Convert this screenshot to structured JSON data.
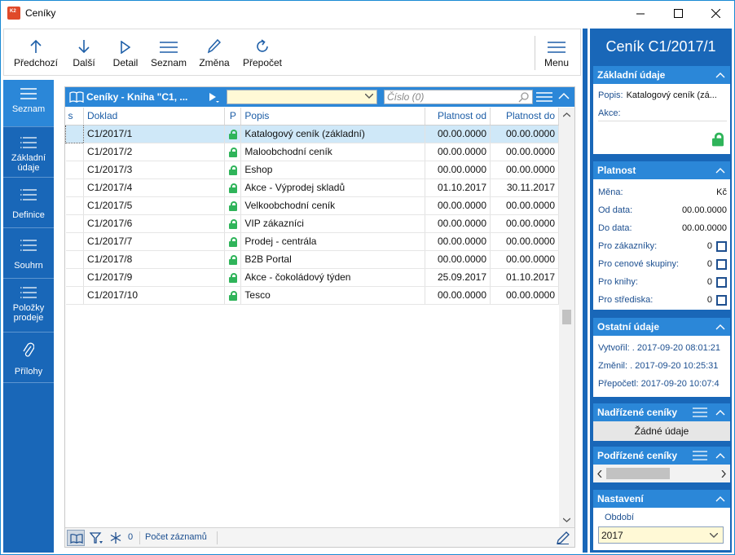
{
  "window": {
    "title": "Ceníky"
  },
  "toolbar": {
    "buttons": [
      {
        "label": "Předchozí",
        "icon": "arrow-up-icon"
      },
      {
        "label": "Další",
        "icon": "arrow-down-icon"
      },
      {
        "label": "Detail",
        "icon": "play-icon"
      },
      {
        "label": "Seznam",
        "icon": "list-icon"
      },
      {
        "label": "Změna",
        "icon": "pencil-icon"
      },
      {
        "label": "Přepočet",
        "icon": "refresh-icon"
      }
    ],
    "menu_label": "Menu"
  },
  "leftnav": {
    "items": [
      {
        "label": "Seznam",
        "active": true
      },
      {
        "label": "Základní údaje"
      },
      {
        "label": "Definice"
      },
      {
        "label": "Souhrn"
      },
      {
        "label": "Položky prodeje"
      },
      {
        "label": "Přílohy"
      }
    ]
  },
  "grid": {
    "title": "Ceníky - Kniha \"C1, ...",
    "filter_value": "",
    "number_placeholder": "Číslo (0)",
    "columns": [
      "s",
      "Doklad",
      "P",
      "Popis",
      "Platnost od",
      "Platnost do"
    ],
    "rows": [
      {
        "doklad": "C1/2017/1",
        "popis": "Katalogový ceník (základní)",
        "od": "00.00.0000",
        "do": "00.00.0000"
      },
      {
        "doklad": "C1/2017/2",
        "popis": "Maloobchodní ceník",
        "od": "00.00.0000",
        "do": "00.00.0000"
      },
      {
        "doklad": "C1/2017/3",
        "popis": "Eshop",
        "od": "00.00.0000",
        "do": "00.00.0000"
      },
      {
        "doklad": "C1/2017/4",
        "popis": "Akce - Výprodej skladů",
        "od": "01.10.2017",
        "do": "30.11.2017"
      },
      {
        "doklad": "C1/2017/5",
        "popis": "Velkoobchodní ceník",
        "od": "00.00.0000",
        "do": "00.00.0000"
      },
      {
        "doklad": "C1/2017/6",
        "popis": "VIP zákazníci",
        "od": "00.00.0000",
        "do": "00.00.0000"
      },
      {
        "doklad": "C1/2017/7",
        "popis": "Prodej - centrála",
        "od": "00.00.0000",
        "do": "00.00.0000"
      },
      {
        "doklad": "C1/2017/8",
        "popis": "B2B Portal",
        "od": "00.00.0000",
        "do": "00.00.0000"
      },
      {
        "doklad": "C1/2017/9",
        "popis": "Akce - čokoládový týden",
        "od": "25.09.2017",
        "do": "01.10.2017"
      },
      {
        "doklad": "C1/2017/10",
        "popis": "Tesco",
        "od": "00.00.0000",
        "do": "00.00.0000"
      }
    ],
    "footer": {
      "count": "0",
      "count_label": "Počet záznamů"
    }
  },
  "detail": {
    "title": "Ceník C1/2017/1",
    "zakladni": {
      "header": "Základní údaje",
      "popis_label": "Popis:",
      "popis_value": "Katalogový ceník (zá...",
      "akce_label": "Akce:"
    },
    "platnost": {
      "header": "Platnost",
      "mena_label": "Měna:",
      "mena_value": "Kč",
      "od_label": "Od data:",
      "od_value": "00.00.0000",
      "do_label": "Do data:",
      "do_value": "00.00.0000",
      "checks": [
        {
          "label": "Pro zákazníky:",
          "value": "0"
        },
        {
          "label": "Pro cenové skupiny:",
          "value": "0"
        },
        {
          "label": "Pro knihy:",
          "value": "0"
        },
        {
          "label": "Pro střediska:",
          "value": "0"
        }
      ]
    },
    "ostatni": {
      "header": "Ostatní údaje",
      "vytvoril": "Vytvořil: . 2017-09-20 08:01:21",
      "zmenil": "Změnil: . 2017-09-20 10:25:31",
      "prepocetl": "Přepočetl: 2017-09-20 10:07:4"
    },
    "nadrizene": {
      "header": "Nadřízené ceníky",
      "empty": "Žádné údaje"
    },
    "podrizene": {
      "header": "Podřízené ceníky"
    },
    "nastaveni": {
      "header": "Nastavení",
      "obdobi_label": "Období",
      "obdobi_value": "2017"
    }
  },
  "colors": {
    "accent": "#1967b8",
    "accent_light": "#2b87d8",
    "lock": "#2fb45a"
  }
}
